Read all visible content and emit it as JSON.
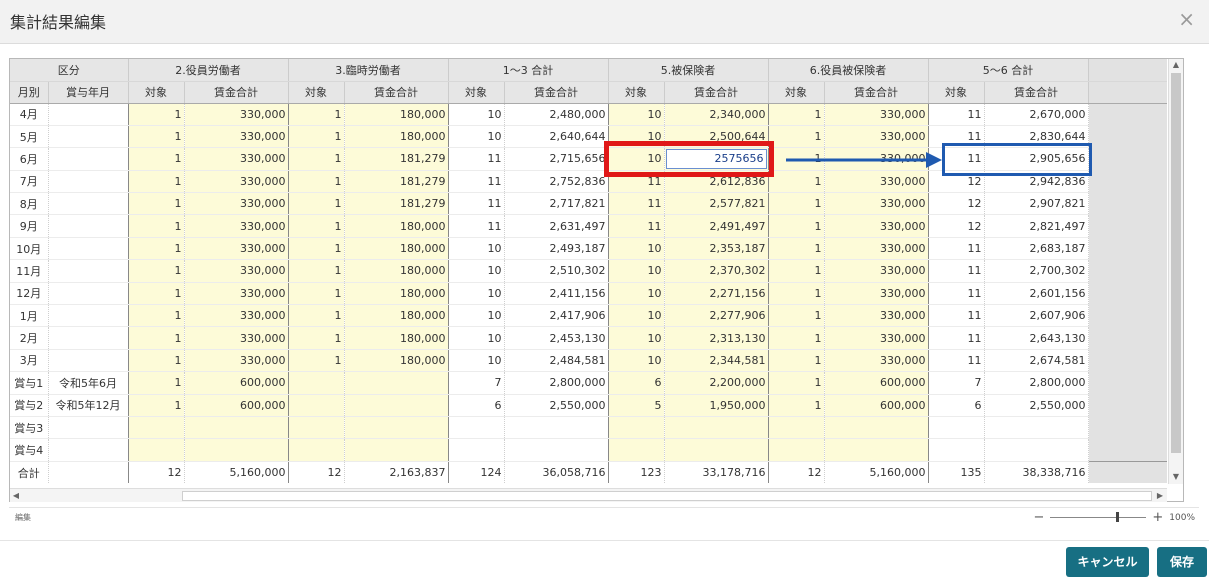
{
  "dialog": {
    "title": "集計結果編集",
    "close_symbol": "×",
    "status_text": "編集",
    "zoom_level": "100%",
    "zoom_fraction": 0.7,
    "cancel_label": "キャンセル",
    "save_label": "保存"
  },
  "headers": {
    "group_kubun": "区分",
    "group_2": "2.役員労働者",
    "group_3": "3.臨時労働者",
    "group_13": "1～3 合計",
    "group_5": "5.被保険者",
    "group_6": "6.役員被保険者",
    "group_56": "5～6 合計",
    "sub_month": "月別",
    "sub_bonus_month": "賞与年月",
    "sub_count": "対象",
    "sub_wage": "賃金合計"
  },
  "rows": [
    {
      "label": "4月",
      "ym": "",
      "c2": "1",
      "w2": "330,000",
      "c3": "1",
      "w3": "180,000",
      "c13": "10",
      "w13": "2,480,000",
      "c5": "10",
      "w5": "2,340,000",
      "c6": "1",
      "w6": "330,000",
      "c56": "11",
      "w56": "2,670,000"
    },
    {
      "label": "5月",
      "ym": "",
      "c2": "1",
      "w2": "330,000",
      "c3": "1",
      "w3": "180,000",
      "c13": "10",
      "w13": "2,640,644",
      "c5": "10",
      "w5": "2,500,644",
      "c6": "1",
      "w6": "330,000",
      "c56": "11",
      "w56": "2,830,644"
    },
    {
      "label": "6月",
      "ym": "",
      "c2": "1",
      "w2": "330,000",
      "c3": "1",
      "w3": "181,279",
      "c13": "11",
      "w13": "2,715,656",
      "c5": "10",
      "w5": "2575656",
      "c6": "1",
      "w6": "330,000",
      "c56": "11",
      "w56": "2,905,656"
    },
    {
      "label": "7月",
      "ym": "",
      "c2": "1",
      "w2": "330,000",
      "c3": "1",
      "w3": "181,279",
      "c13": "11",
      "w13": "2,752,836",
      "c5": "11",
      "w5": "2,612,836",
      "c6": "1",
      "w6": "330,000",
      "c56": "12",
      "w56": "2,942,836"
    },
    {
      "label": "8月",
      "ym": "",
      "c2": "1",
      "w2": "330,000",
      "c3": "1",
      "w3": "181,279",
      "c13": "11",
      "w13": "2,717,821",
      "c5": "11",
      "w5": "2,577,821",
      "c6": "1",
      "w6": "330,000",
      "c56": "12",
      "w56": "2,907,821"
    },
    {
      "label": "9月",
      "ym": "",
      "c2": "1",
      "w2": "330,000",
      "c3": "1",
      "w3": "180,000",
      "c13": "11",
      "w13": "2,631,497",
      "c5": "11",
      "w5": "2,491,497",
      "c6": "1",
      "w6": "330,000",
      "c56": "12",
      "w56": "2,821,497"
    },
    {
      "label": "10月",
      "ym": "",
      "c2": "1",
      "w2": "330,000",
      "c3": "1",
      "w3": "180,000",
      "c13": "10",
      "w13": "2,493,187",
      "c5": "10",
      "w5": "2,353,187",
      "c6": "1",
      "w6": "330,000",
      "c56": "11",
      "w56": "2,683,187"
    },
    {
      "label": "11月",
      "ym": "",
      "c2": "1",
      "w2": "330,000",
      "c3": "1",
      "w3": "180,000",
      "c13": "10",
      "w13": "2,510,302",
      "c5": "10",
      "w5": "2,370,302",
      "c6": "1",
      "w6": "330,000",
      "c56": "11",
      "w56": "2,700,302"
    },
    {
      "label": "12月",
      "ym": "",
      "c2": "1",
      "w2": "330,000",
      "c3": "1",
      "w3": "180,000",
      "c13": "10",
      "w13": "2,411,156",
      "c5": "10",
      "w5": "2,271,156",
      "c6": "1",
      "w6": "330,000",
      "c56": "11",
      "w56": "2,601,156"
    },
    {
      "label": "1月",
      "ym": "",
      "c2": "1",
      "w2": "330,000",
      "c3": "1",
      "w3": "180,000",
      "c13": "10",
      "w13": "2,417,906",
      "c5": "10",
      "w5": "2,277,906",
      "c6": "1",
      "w6": "330,000",
      "c56": "11",
      "w56": "2,607,906"
    },
    {
      "label": "2月",
      "ym": "",
      "c2": "1",
      "w2": "330,000",
      "c3": "1",
      "w3": "180,000",
      "c13": "10",
      "w13": "2,453,130",
      "c5": "10",
      "w5": "2,313,130",
      "c6": "1",
      "w6": "330,000",
      "c56": "11",
      "w56": "2,643,130"
    },
    {
      "label": "3月",
      "ym": "",
      "c2": "1",
      "w2": "330,000",
      "c3": "1",
      "w3": "180,000",
      "c13": "10",
      "w13": "2,484,581",
      "c5": "10",
      "w5": "2,344,581",
      "c6": "1",
      "w6": "330,000",
      "c56": "11",
      "w56": "2,674,581"
    },
    {
      "label": "賞与1",
      "ym": "令和5年6月",
      "c2": "1",
      "w2": "600,000",
      "c3": "",
      "w3": "",
      "c13": "7",
      "w13": "2,800,000",
      "c5": "6",
      "w5": "2,200,000",
      "c6": "1",
      "w6": "600,000",
      "c56": "7",
      "w56": "2,800,000"
    },
    {
      "label": "賞与2",
      "ym": "令和5年12月",
      "c2": "1",
      "w2": "600,000",
      "c3": "",
      "w3": "",
      "c13": "6",
      "w13": "2,550,000",
      "c5": "5",
      "w5": "1,950,000",
      "c6": "1",
      "w6": "600,000",
      "c56": "6",
      "w56": "2,550,000"
    },
    {
      "label": "賞与3",
      "ym": "",
      "c2": "",
      "w2": "",
      "c3": "",
      "w3": "",
      "c13": "",
      "w13": "",
      "c5": "",
      "w5": "",
      "c6": "",
      "w6": "",
      "c56": "",
      "w56": ""
    },
    {
      "label": "賞与4",
      "ym": "",
      "c2": "",
      "w2": "",
      "c3": "",
      "w3": "",
      "c13": "",
      "w13": "",
      "c5": "",
      "w5": "",
      "c6": "",
      "w6": "",
      "c56": "",
      "w56": ""
    }
  ],
  "total": {
    "label": "合計",
    "ym": "",
    "c2": "12",
    "w2": "5,160,000",
    "c3": "12",
    "w3": "2,163,837",
    "c13": "124",
    "w13": "36,058,716",
    "c5": "123",
    "w5": "33,178,716",
    "c6": "12",
    "w6": "5,160,000",
    "c56": "135",
    "w56": "38,338,716"
  },
  "editing": {
    "row": 2,
    "column": "w5"
  },
  "colors": {
    "accent": "#176f83",
    "input_cell": "#fdfbd8",
    "highlight_red": "#e01818",
    "highlight_blue": "#1f5ab0"
  }
}
